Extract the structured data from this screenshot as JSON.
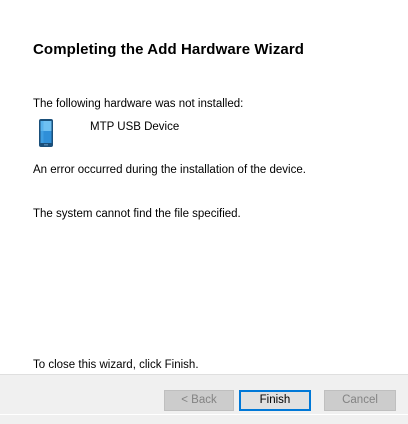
{
  "wizard": {
    "title": "Completing the Add Hardware Wizard",
    "not_installed_label": "The following hardware was not installed:",
    "device": {
      "name": "MTP USB Device",
      "icon": "portable-device-icon"
    },
    "error_message": "An error occurred during the installation of the device.",
    "system_message": "The system cannot find the file specified.",
    "close_hint": "To close this wizard, click Finish."
  },
  "buttons": {
    "back_label": "< Back",
    "finish_label": "Finish",
    "cancel_label": "Cancel"
  },
  "colors": {
    "focus_border": "#0078d7",
    "footer_background": "#f0f0f0",
    "disabled_text": "#838383"
  }
}
